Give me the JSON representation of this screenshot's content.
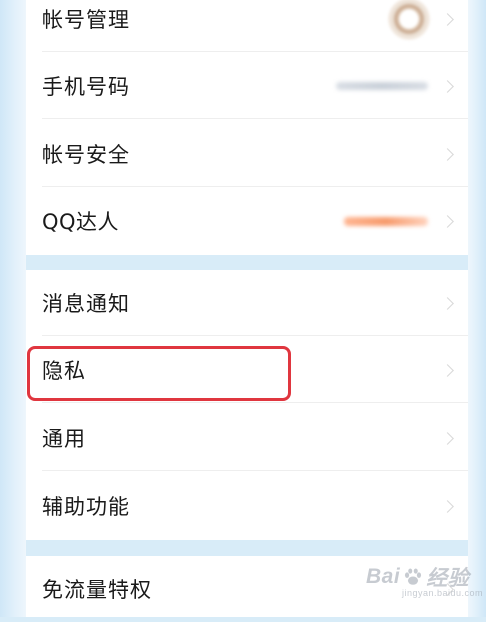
{
  "settings": {
    "group1": [
      {
        "label": "帐号管理",
        "accessory": "avatar"
      },
      {
        "label": "手机号码",
        "accessory": "masked-phone"
      },
      {
        "label": "帐号安全",
        "accessory": "none"
      },
      {
        "label": "QQ达人",
        "accessory": "status-text"
      }
    ],
    "group2": [
      {
        "label": "消息通知"
      },
      {
        "label": "隐私"
      },
      {
        "label": "通用"
      },
      {
        "label": "辅助功能"
      }
    ],
    "group3": [
      {
        "label": "免流量特权"
      }
    ]
  },
  "annotation": {
    "highlight_color": "#e0363f",
    "highlighted_item": "隐私"
  },
  "watermark": {
    "logo_left": "Bai",
    "logo_right": "经验",
    "sub": "jingyan.baidu.com"
  },
  "colors": {
    "background": "#d8ecf8",
    "panel": "#ffffff",
    "text": "#1a1a1a",
    "chevron": "#d9d9d9",
    "qq_status": "#f79a6b"
  },
  "icons": {
    "chevron": "chevron-right-icon",
    "avatar": "avatar",
    "watermark_paw": "paw-icon"
  }
}
